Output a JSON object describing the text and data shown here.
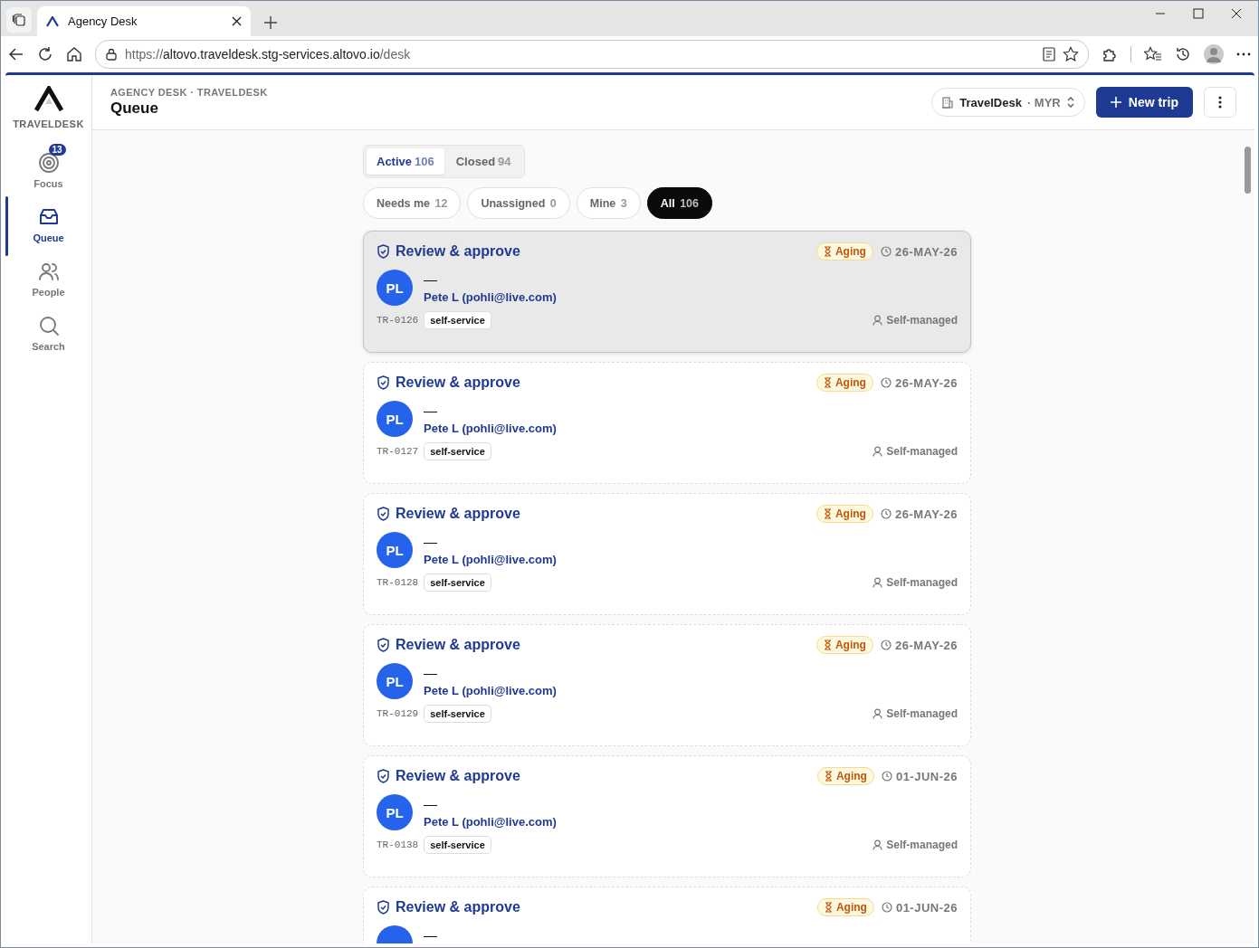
{
  "browser": {
    "tab_title": "Agency Desk",
    "url_scheme": "https://",
    "url_host": "altovo.traveldesk.stg-services.altovo.io",
    "url_path": "/desk"
  },
  "sidebar": {
    "brand": "TRAVELDESK",
    "items": [
      {
        "kind": "focus",
        "label": "Focus",
        "badge": "13",
        "selected": false
      },
      {
        "kind": "queue",
        "label": "Queue",
        "selected": true
      },
      {
        "kind": "people",
        "label": "People",
        "selected": false
      },
      {
        "kind": "search",
        "label": "Search",
        "selected": false
      }
    ]
  },
  "header": {
    "breadcrumb": "AGENCY DESK · TRAVELDESK",
    "title": "Queue",
    "workspace": {
      "name": "TravelDesk",
      "currency": "· MYR"
    },
    "new_button": "New trip"
  },
  "status_tabs": [
    {
      "label": "Active",
      "count": "106",
      "selected": true
    },
    {
      "label": "Closed",
      "count": "94",
      "selected": false
    }
  ],
  "filters": [
    {
      "label": "Needs me",
      "count": "12",
      "selected": false
    },
    {
      "label": "Unassigned",
      "count": "0",
      "selected": false
    },
    {
      "label": "Mine",
      "count": "3",
      "selected": false
    },
    {
      "label": "All",
      "count": "106",
      "selected": true
    }
  ],
  "cards": [
    {
      "title": "Review & approve",
      "badge": "Aging",
      "date": "26-MAY-26",
      "initials": "PL",
      "primary": "—",
      "contact": "Pete L (pohli@live.com)",
      "trip_id": "TR-0126",
      "tag": "self-service",
      "owner": "Self-managed",
      "hovered": true
    },
    {
      "title": "Review & approve",
      "badge": "Aging",
      "date": "26-MAY-26",
      "initials": "PL",
      "primary": "—",
      "contact": "Pete L (pohli@live.com)",
      "trip_id": "TR-0127",
      "tag": "self-service",
      "owner": "Self-managed",
      "hovered": false
    },
    {
      "title": "Review & approve",
      "badge": "Aging",
      "date": "26-MAY-26",
      "initials": "PL",
      "primary": "—",
      "contact": "Pete L (pohli@live.com)",
      "trip_id": "TR-0128",
      "tag": "self-service",
      "owner": "Self-managed",
      "hovered": false
    },
    {
      "title": "Review & approve",
      "badge": "Aging",
      "date": "26-MAY-26",
      "initials": "PL",
      "primary": "—",
      "contact": "Pete L (pohli@live.com)",
      "trip_id": "TR-0129",
      "tag": "self-service",
      "owner": "Self-managed",
      "hovered": false
    },
    {
      "title": "Review & approve",
      "badge": "Aging",
      "date": "01-JUN-26",
      "initials": "PL",
      "primary": "—",
      "contact": "Pete L (pohli@live.com)",
      "trip_id": "TR-0138",
      "tag": "self-service",
      "owner": "Self-managed",
      "hovered": false
    },
    {
      "title": "Review & approve",
      "badge": "Aging",
      "date": "01-JUN-26",
      "primary": "—",
      "hovered": false
    }
  ]
}
